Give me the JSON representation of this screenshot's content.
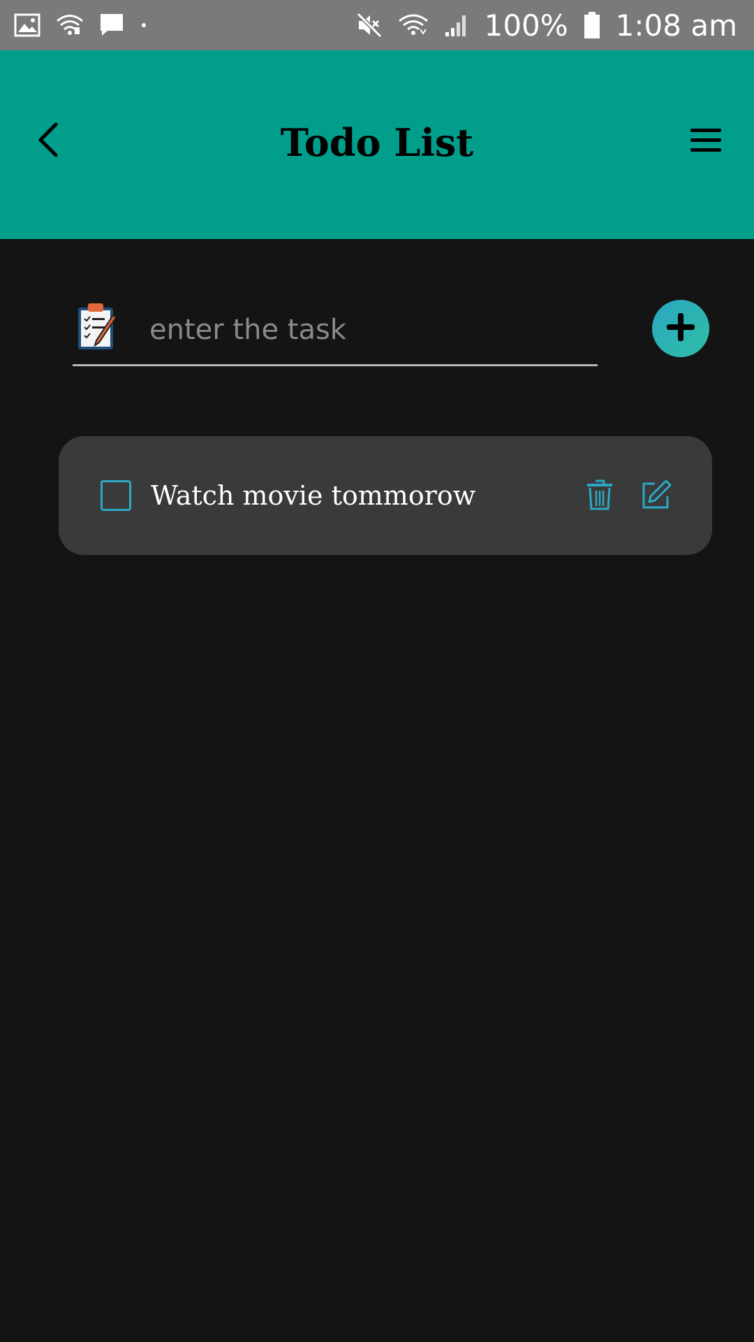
{
  "status_bar": {
    "battery_text": "100%",
    "time": "1:08 am",
    "icons": [
      "image-icon",
      "wifi-icon",
      "message-icon",
      "dot-icon",
      "mute-icon",
      "wifi-icon",
      "signal-icon",
      "battery-icon"
    ]
  },
  "app_bar": {
    "title": "Todo List",
    "background_color": "#009e8b",
    "icons": [
      "back-arrow-icon",
      "hamburger-menu-icon"
    ]
  },
  "task_input": {
    "placeholder": "enter the task",
    "value": "",
    "icon": "clipboard-icon",
    "add_icon": "plus-icon"
  },
  "tasks": [
    {
      "text": "Watch movie tommorow",
      "checked": false,
      "icons": [
        "trash-icon",
        "edit-icon"
      ]
    }
  ],
  "colors": {
    "background": "#141414",
    "card": "#3a3a3a",
    "accent": "#2ba9c4"
  }
}
